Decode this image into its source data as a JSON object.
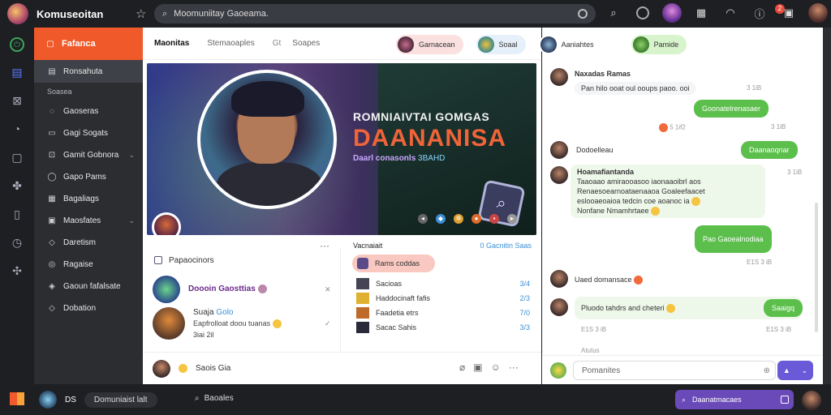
{
  "app": {
    "name": "Komuseoitan",
    "notif_count": "2"
  },
  "topbar": {
    "search_value": "Moomuniitay Gaoeama.",
    "search_placeholder": "Search"
  },
  "sidebar": {
    "header": "Fafanca",
    "selected": "Ronsahuta",
    "section": "Soasea",
    "items": [
      {
        "label": "Gaoseras",
        "chevron": false
      },
      {
        "label": "Gagi Sogats",
        "chevron": false
      },
      {
        "label": "Gamit Gobnora",
        "chevron": true
      },
      {
        "label": "Gapo Pams",
        "chevron": false
      },
      {
        "label": "Bagaliags",
        "chevron": false
      },
      {
        "label": "Maosfates",
        "chevron": true
      },
      {
        "label": "Daretism",
        "chevron": false
      },
      {
        "label": "Ragaise",
        "chevron": false
      },
      {
        "label": "Gaoun fafalsate",
        "chevron": false
      },
      {
        "label": "Dobation",
        "chevron": false
      }
    ]
  },
  "main": {
    "tabs": [
      "Maonitas",
      "Stemaoaples",
      "Gt",
      "Soapes"
    ],
    "banner": {
      "title": "ROMNIAIVTAI GOMGAS",
      "big": "DAANANISA",
      "sub_a": "Daarl conasonls",
      "sub_b": "3BAHD"
    },
    "more": "···",
    "left_section": "Papaocinors",
    "feed": [
      {
        "name": "Doooin Gaosttias",
        "meta": "",
        "right": "✕"
      },
      {
        "name": "Suaja",
        "name_tag": "Golo",
        "meta": "Eapfrolloat doou tuanas",
        "meta2": "3iai 2il",
        "right": "✓"
      }
    ],
    "right_section": "Vacnaiait",
    "right_link": "0 Gacnitin Saas",
    "pill": "Rams coddas",
    "list": [
      {
        "label": "Sacioas",
        "num": "3/4"
      },
      {
        "label": "Haddocinaft fafis",
        "num": "2/3"
      },
      {
        "label": "Faadetia etrs",
        "num": "7/0"
      },
      {
        "label": "Sacac Sahis",
        "num": "3/3"
      }
    ],
    "composer": "Saois Gia"
  },
  "chat": {
    "chips": [
      "Garnacean",
      "Soaal",
      "Aaniahtes",
      "Pamide"
    ],
    "messages": [
      {
        "name": "Naxadas Ramas",
        "text": "Pan hilo ooat oul ooups paoo. ooi",
        "time": "3 1iB"
      },
      {
        "bubble": "Goonatelrenasaer",
        "time": "5 1if2"
      },
      {
        "name": "Dodoelleau",
        "bubble": "Daanaoqnar",
        "time": "3 1iB"
      },
      {
        "name": "Hoamafiantanda",
        "text1": "Taaoaao amiraooasoo iaonaaoibrl aos",
        "text2": "Renaesoearnoataenaaoa Goaleefaacet",
        "text3": "eslooaeoaioa tedcin coe aoanoc ia",
        "text4": "Nonfane Nmamhrtaee",
        "time": "3 1iB"
      },
      {
        "bubble": "Pao Gaoealnodiaa",
        "time": "E1S 3 iB"
      },
      {
        "name": "Uaed domansace"
      },
      {
        "name": "Pluodo tahdrs and cheteri",
        "bubble": "Saaigq",
        "time": "E1S 3 iB"
      }
    ],
    "status": "Atutus",
    "input_placeholder": "Pomanites"
  },
  "bottombar": {
    "user_tag": "DS",
    "user_name": "Domuniaist lalt",
    "search": "Baoales",
    "right_pill": "Daanatmacaes"
  },
  "colors": {
    "accent": "#f05a2a",
    "chat_green": "#5cbf4c",
    "send": "#6a5ad8"
  }
}
